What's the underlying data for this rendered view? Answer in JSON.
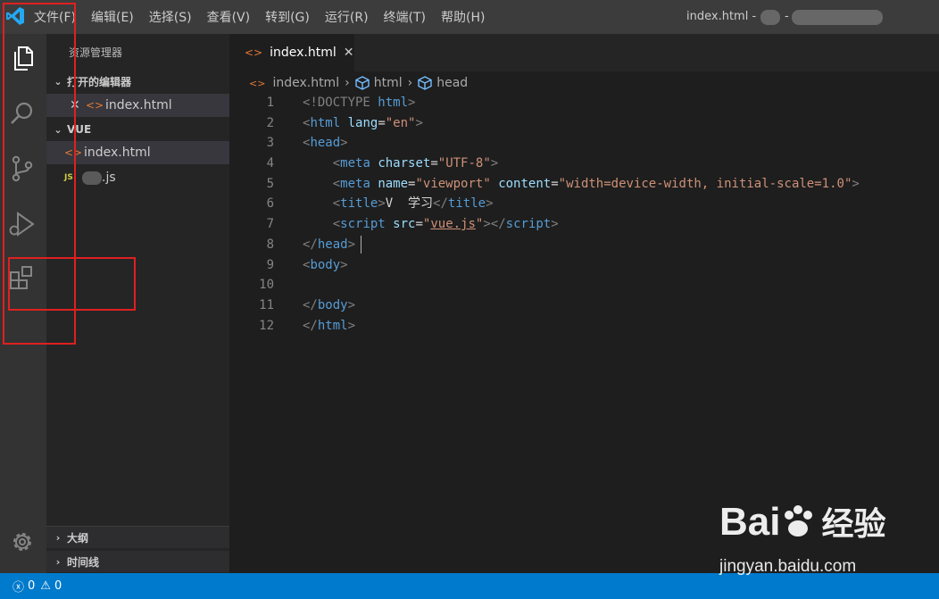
{
  "menu": [
    "文件(F)",
    "编辑(E)",
    "选择(S)",
    "查看(V)",
    "转到(G)",
    "运行(R)",
    "终端(T)",
    "帮助(H)"
  ],
  "window": {
    "title": "index.html -",
    "title_sep": "-"
  },
  "sidebar": {
    "title": "资源管理器",
    "open_editors": {
      "label": "打开的编辑器",
      "file": "index.html"
    },
    "folder": {
      "label": "VUE",
      "files": [
        {
          "name": "index.html",
          "icon": "<>"
        },
        {
          "name": ".js",
          "icon": "JS"
        }
      ]
    },
    "outline": "大纲",
    "timeline": "时间线"
  },
  "editor": {
    "tab": {
      "label": "index.html",
      "icon": "<>"
    },
    "breadcrumb": [
      "index.html",
      "html",
      "head"
    ],
    "lines": [
      [
        {
          "t": "<!DOCTYPE ",
          "c": "#808080"
        },
        {
          "t": "html",
          "c": "#569cd6"
        },
        {
          "t": ">",
          "c": "#808080"
        }
      ],
      [
        {
          "t": "<",
          "c": "#808080"
        },
        {
          "t": "html",
          "c": "#569cd6"
        },
        {
          "t": " ",
          "c": "#d4d4d4"
        },
        {
          "t": "lang",
          "c": "#9cdcfe"
        },
        {
          "t": "=",
          "c": "#d4d4d4"
        },
        {
          "t": "\"en\"",
          "c": "#ce9178"
        },
        {
          "t": ">",
          "c": "#808080"
        }
      ],
      [
        {
          "t": "<",
          "c": "#808080"
        },
        {
          "t": "head",
          "c": "#569cd6"
        },
        {
          "t": ">",
          "c": "#808080"
        }
      ],
      [
        {
          "t": "    <",
          "c": "#808080"
        },
        {
          "t": "meta",
          "c": "#569cd6"
        },
        {
          "t": " ",
          "c": "#d4d4d4"
        },
        {
          "t": "charset",
          "c": "#9cdcfe"
        },
        {
          "t": "=",
          "c": "#d4d4d4"
        },
        {
          "t": "\"UTF-8\"",
          "c": "#ce9178"
        },
        {
          "t": ">",
          "c": "#808080"
        }
      ],
      [
        {
          "t": "    <",
          "c": "#808080"
        },
        {
          "t": "meta",
          "c": "#569cd6"
        },
        {
          "t": " ",
          "c": "#d4d4d4"
        },
        {
          "t": "name",
          "c": "#9cdcfe"
        },
        {
          "t": "=",
          "c": "#d4d4d4"
        },
        {
          "t": "\"viewport\"",
          "c": "#ce9178"
        },
        {
          "t": " ",
          "c": "#d4d4d4"
        },
        {
          "t": "content",
          "c": "#9cdcfe"
        },
        {
          "t": "=",
          "c": "#d4d4d4"
        },
        {
          "t": "\"width=device-width, initial-scale=1.0\"",
          "c": "#ce9178"
        },
        {
          "t": ">",
          "c": "#808080"
        }
      ],
      [
        {
          "t": "    <",
          "c": "#808080"
        },
        {
          "t": "title",
          "c": "#569cd6"
        },
        {
          "t": ">",
          "c": "#808080"
        },
        {
          "t": "V  学习",
          "c": "#d4d4d4"
        },
        {
          "t": "</",
          "c": "#808080"
        },
        {
          "t": "title",
          "c": "#569cd6"
        },
        {
          "t": ">",
          "c": "#808080"
        }
      ],
      [
        {
          "t": "    <",
          "c": "#808080"
        },
        {
          "t": "script",
          "c": "#569cd6"
        },
        {
          "t": " ",
          "c": "#d4d4d4"
        },
        {
          "t": "src",
          "c": "#9cdcfe"
        },
        {
          "t": "=",
          "c": "#d4d4d4"
        },
        {
          "t": "\"",
          "c": "#ce9178"
        },
        {
          "t": "vue.js",
          "c": "#ce9178",
          "u": true
        },
        {
          "t": "\"",
          "c": "#ce9178"
        },
        {
          "t": "></",
          "c": "#808080"
        },
        {
          "t": "script",
          "c": "#569cd6"
        },
        {
          "t": ">",
          "c": "#808080"
        }
      ],
      [
        {
          "t": "</",
          "c": "#808080"
        },
        {
          "t": "head",
          "c": "#569cd6"
        },
        {
          "t": ">",
          "c": "#808080"
        }
      ],
      [
        {
          "t": "<",
          "c": "#808080"
        },
        {
          "t": "body",
          "c": "#569cd6"
        },
        {
          "t": ">",
          "c": "#808080"
        }
      ],
      [],
      [
        {
          "t": "</",
          "c": "#808080"
        },
        {
          "t": "body",
          "c": "#569cd6"
        },
        {
          "t": ">",
          "c": "#808080"
        }
      ],
      [
        {
          "t": "</",
          "c": "#808080"
        },
        {
          "t": "html",
          "c": "#569cd6"
        },
        {
          "t": ">",
          "c": "#808080"
        }
      ]
    ]
  },
  "status": {
    "errors": "0",
    "warnings": "0"
  },
  "watermark": {
    "brand": "Bai",
    "brand2": "du",
    "suffix": "经验",
    "url": "jingyan.baidu.com"
  },
  "colors": {
    "accent": "#007acc",
    "annotation": "#e02020"
  }
}
